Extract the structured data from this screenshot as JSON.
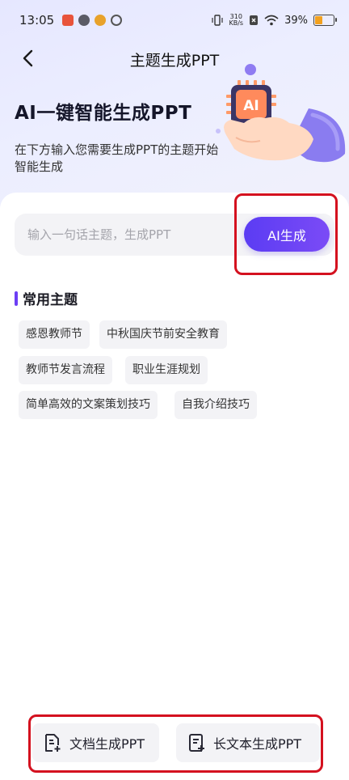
{
  "status_bar": {
    "time": "13:05",
    "net_speed_value": "310",
    "net_speed_unit": "KB/s",
    "battery_percent": "39%",
    "battery_level": 0.39,
    "battery_color": "#f3a11f"
  },
  "header": {
    "title": "主题生成PPT",
    "back_icon": "chevron-left-icon"
  },
  "hero": {
    "title": "AI一键智能生成PPT",
    "subtitle": "在下方输入您需要生成PPT的主题开始智能生成",
    "badge_text": "AI"
  },
  "input": {
    "placeholder": "输入一句话主题，生成PPT",
    "value": ""
  },
  "generate_button": {
    "label": "AI生成"
  },
  "topics": {
    "heading": "常用主题",
    "items": [
      "感恩教师节",
      "中秋国庆节前安全教育",
      "教师节发言流程",
      "职业生涯规划",
      "简单高效的文案策划技巧",
      "自我介绍技巧"
    ]
  },
  "bottom_actions": {
    "doc_label": "文档生成PPT",
    "longtext_label": "长文本生成PPT",
    "doc_icon": "document-add-icon",
    "longtext_icon": "long-text-add-icon"
  },
  "colors": {
    "accent": "#6c3ef5",
    "highlight": "#d4111f"
  }
}
